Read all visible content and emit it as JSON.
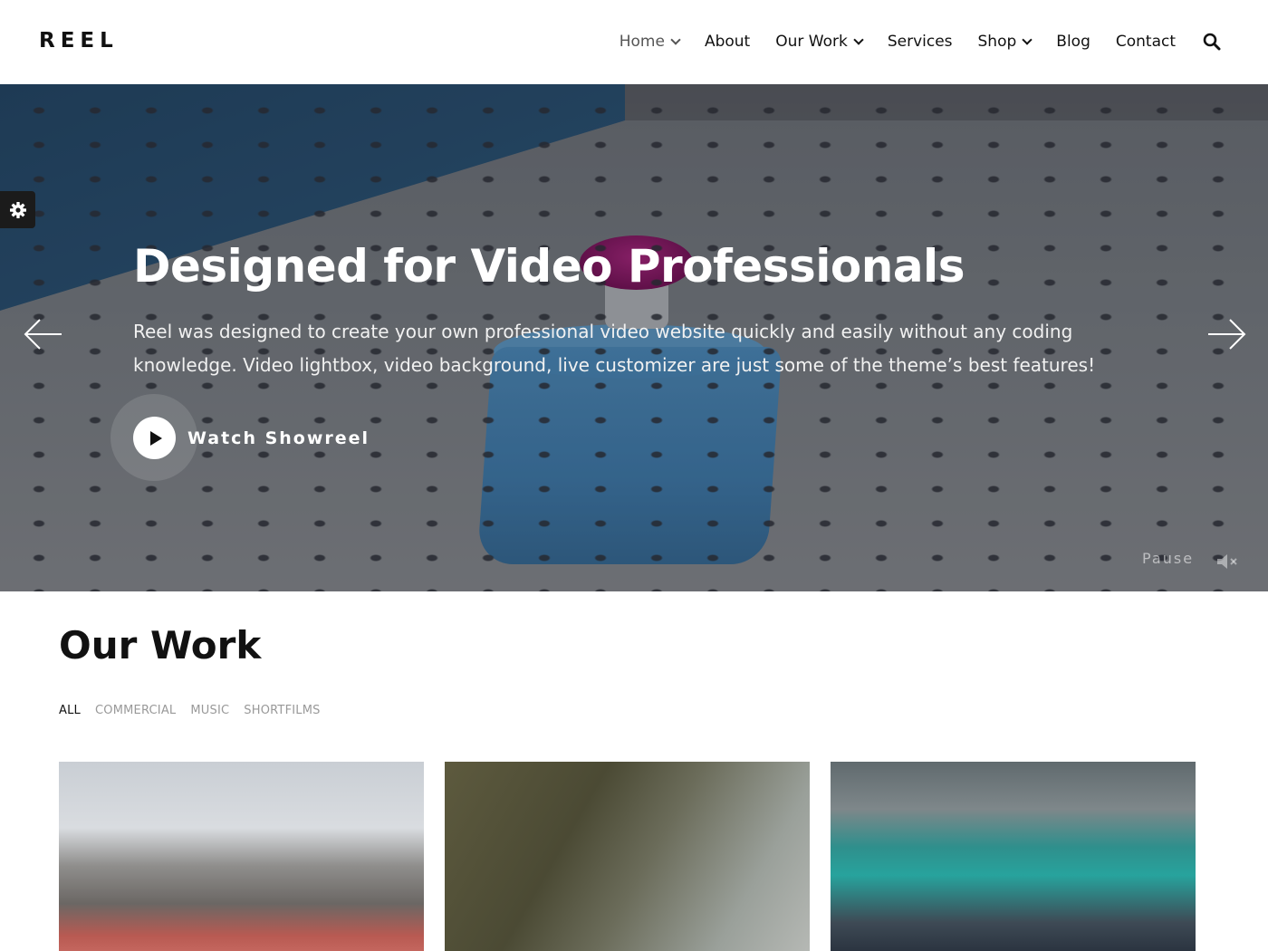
{
  "header": {
    "logo": "REEL",
    "nav": [
      {
        "label": "Home",
        "has_dropdown": true,
        "active": true
      },
      {
        "label": "About",
        "has_dropdown": false
      },
      {
        "label": "Our Work",
        "has_dropdown": true
      },
      {
        "label": "Services",
        "has_dropdown": false
      },
      {
        "label": "Shop",
        "has_dropdown": true
      },
      {
        "label": "Blog",
        "has_dropdown": false
      },
      {
        "label": "Contact",
        "has_dropdown": false
      }
    ],
    "search_icon": "search-icon"
  },
  "hero": {
    "title": "Designed for Video Professionals",
    "description": "Reel was designed to create your own professional video website quickly and easily without any coding knowledge. Video lightbox, video background, live customizer are just some of the theme’s best features!",
    "watch_label": "Watch Showreel",
    "pause_label": "Pause",
    "icons": {
      "prev": "arrow-left-icon",
      "next": "arrow-right-icon",
      "play": "play-icon",
      "mute": "mute-icon",
      "settings": "gear-icon"
    }
  },
  "work": {
    "title": "Our Work",
    "filters": [
      "ALL",
      "COMMERCIAL",
      "MUSIC",
      "SHORTFILMS"
    ],
    "active_filter": "ALL"
  },
  "colors": {
    "text": "#111111",
    "muted": "#999999",
    "settings_bg": "#1b1b1b"
  }
}
